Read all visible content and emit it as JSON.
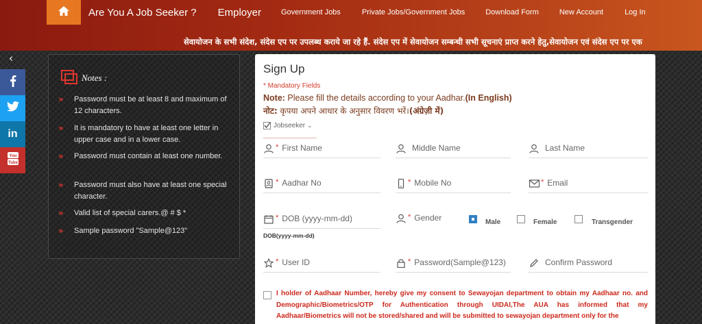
{
  "header": {
    "home_icon": "home-icon",
    "nav": [
      "Are You A Job Seeker ?",
      "Employer",
      "Government Jobs",
      "Private Jobs/Government Jobs",
      "Download Form",
      "New Account",
      "Log In"
    ],
    "marquee": "सेवायोजन के सभी संदेश, संदेस एप पर उपलब्ध कराये जा रहे हैं.   संदेस एप में सेवायोजन सम्बन्धी सभी सूचनाएं प्राप्त करने हेतु,सेवायोजन एवं संदेस एप पर एक"
  },
  "back_label": "‹",
  "social": [
    {
      "name": "facebook",
      "glyph": "f",
      "color": "#3b5998"
    },
    {
      "name": "twitter",
      "glyph": "t",
      "color": "#1da1f2"
    },
    {
      "name": "linkedin",
      "glyph": "in",
      "color": "#0e76a8"
    },
    {
      "name": "youtube",
      "glyph": "You",
      "color": "#c4302b"
    }
  ],
  "notes": {
    "title": "Notes :",
    "items": [
      "Password must be at least 8 and maximum of 12 characters.",
      "It is mandatory to have at least one letter in upper case and in a lower case.",
      "Password must contain at least one number.",
      "Password must also have at least one special character.",
      "Valid list of special carers.@ # $ *",
      "Sample password \"Sample@123\""
    ]
  },
  "signup": {
    "title": "Sign Up",
    "mandatory": "* Mandatory Fields",
    "note_en_label": "Note:",
    "note_en_text": " Please fill the details according to your Aadhar.",
    "note_en_bold": "(In English)",
    "note_hi_label": "नोट:",
    "note_hi_text": " कृपया अपने आधार के अनुसार विवरण भरें।",
    "note_hi_bold": "(अंग्रेज़ी में)",
    "user_type": "Jobseeker",
    "fields": {
      "first_name": "First Name",
      "middle_name": "Middle Name",
      "last_name": "Last Name",
      "aadhar": "Aadhar No",
      "mobile": "Mobile No",
      "email": "Email",
      "dob": "DOB (yyyy-mm-dd)",
      "gender": "Gender",
      "user_id": "User ID",
      "password": "Password(Sample@123)",
      "confirm_password": "Confirm Password"
    },
    "gender_options": [
      "Male",
      "Female",
      "Transgender"
    ],
    "gender_selected": "Male",
    "dob_hint": "DOB(yyyy-mm-dd)",
    "consent_red": "I holder of Aadhaar Number, hereby give my consent to Sewayojan department to obtain my Aadhaar no. and Demographic/Biometrics/OTP for Authentication through UIDAI,The AUA has informed that my Aadhaar/Biometrics will not be stored/shared and will be submitted to sewayojan department only for the"
  },
  "colors": {
    "header_start": "#8a1a10",
    "header_end": "#c8561e",
    "home_btn": "#e87722",
    "mandatory": "#d43a2a",
    "consent": "#cc2a1e",
    "gender_selected": "#2f7fc2"
  }
}
